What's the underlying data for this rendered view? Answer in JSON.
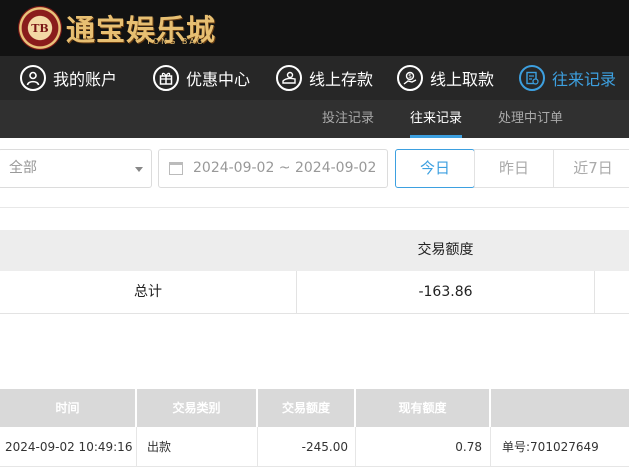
{
  "brand": {
    "badge": "TB",
    "name": "通宝娱乐城",
    "sub": "TONG BAO"
  },
  "nav": {
    "items": [
      {
        "label": "我的账户",
        "icon": "user-icon"
      },
      {
        "label": "优惠中心",
        "icon": "gift-icon"
      },
      {
        "label": "线上存款",
        "icon": "deposit-icon"
      },
      {
        "label": "线上取款",
        "icon": "withdraw-icon"
      },
      {
        "label": "往来记录",
        "icon": "record-icon",
        "active": true
      }
    ]
  },
  "subtabs": {
    "items": [
      {
        "label": "投注记录"
      },
      {
        "label": "往来记录",
        "active": true
      },
      {
        "label": "处理中订单"
      }
    ]
  },
  "filter": {
    "type_value": "全部",
    "date_range": "2024-09-02 ~ 2024-09-02",
    "quick": [
      "今日",
      "昨日",
      "近7日"
    ],
    "active_quick": "今日"
  },
  "summary": {
    "header": "交易额度",
    "label": "总计",
    "total": "-163.86"
  },
  "details": {
    "columns": [
      "时间",
      "交易类别",
      "交易额度",
      "现有额度",
      ""
    ],
    "rows": [
      {
        "time": "2024-09-02 10:49:16",
        "type": "出款",
        "amount": "-245.00",
        "balance": "0.78",
        "order": "单号:701027649"
      }
    ]
  },
  "colors": {
    "accent": "#3da0e0",
    "header_bg": "#121212",
    "nav_bg": "#272727",
    "gold": "#e7bf72"
  }
}
